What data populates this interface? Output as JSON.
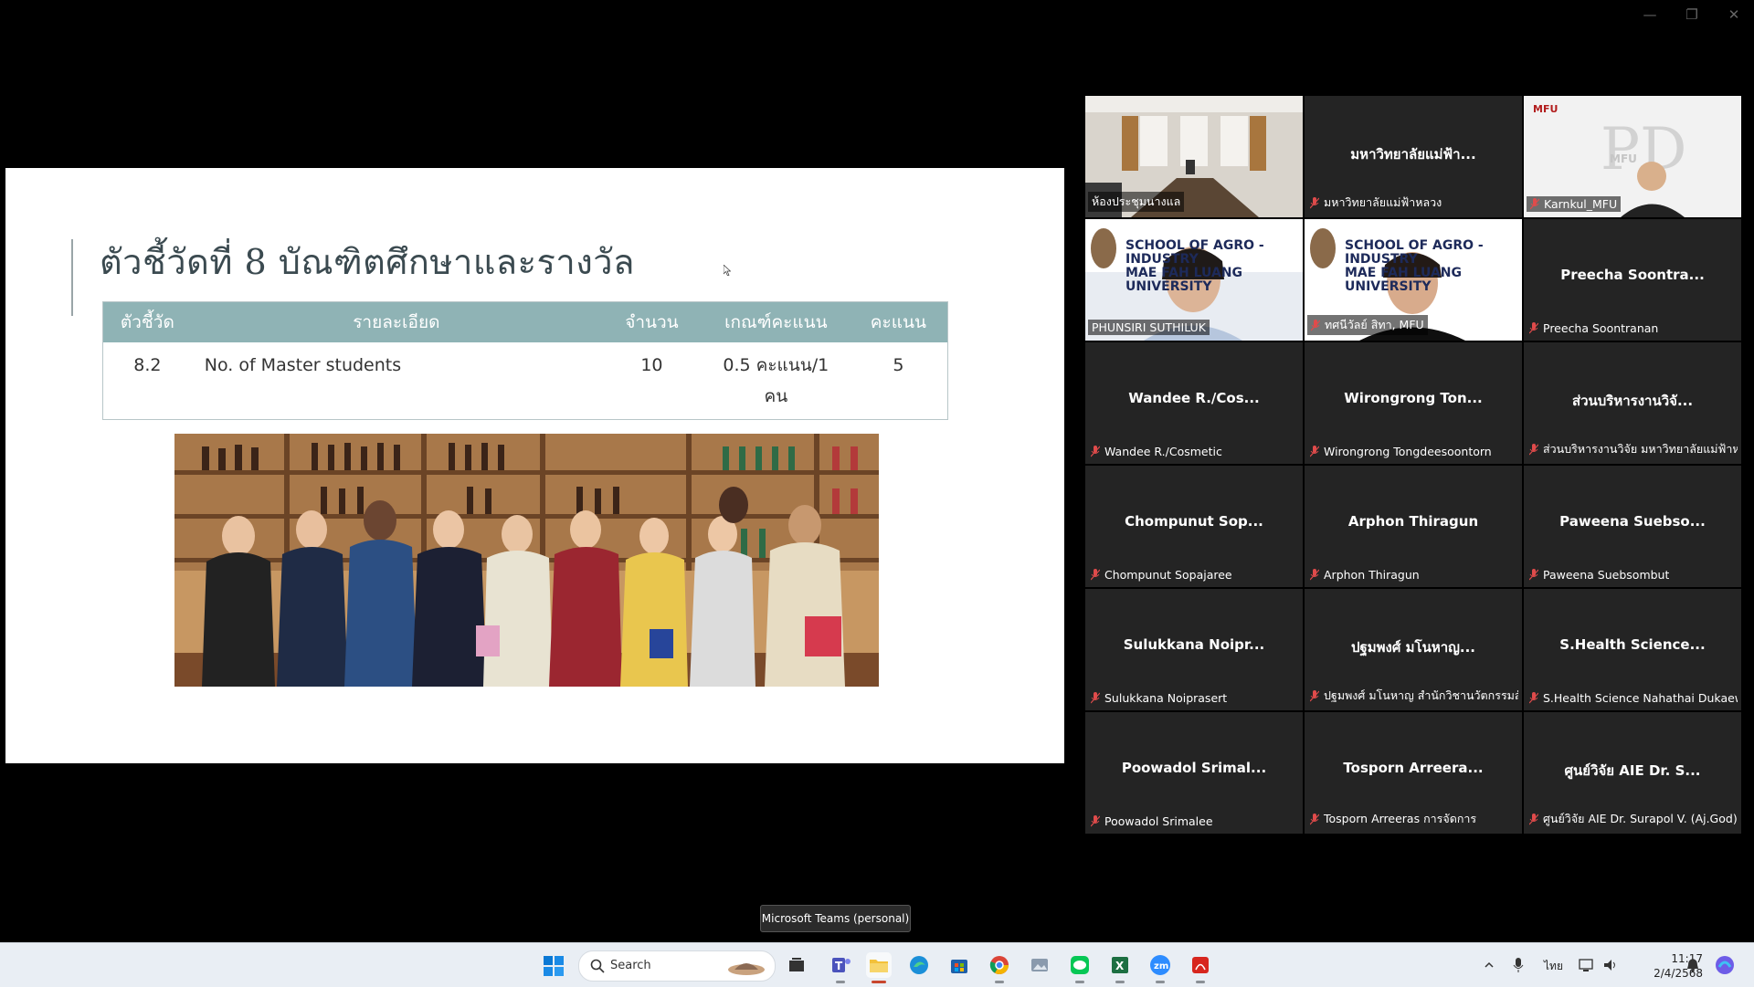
{
  "window": {
    "controls": [
      "minimize",
      "restore",
      "close"
    ]
  },
  "slide": {
    "title": "ตัวชี้วัดที่ 8 บัณฑิตศึกษาและรางวัล",
    "table": {
      "headers": [
        "ตัวชี้วัด",
        "รายละเอียด",
        "จำนวน",
        "เกณฑ์คะแนน",
        "คะแนน"
      ],
      "rows": [
        {
          "indicator": "8.2",
          "detail": "No. of Master students",
          "count": "10",
          "criteria": "0.5 คะแนน/1 คน",
          "score": "5"
        }
      ]
    }
  },
  "gallery": {
    "tiles": [
      {
        "name": "",
        "label": "ห้องประชุมนางแล",
        "type": "video-room",
        "muted": false
      },
      {
        "name": "มหาวิทยาลัยแม่ฟ้า...",
        "label": "มหาวิทยาลัยแม่ฟ้าหลวง",
        "type": "name",
        "muted": true
      },
      {
        "name": "",
        "label": "Karnkul_MFU",
        "type": "video-mfu",
        "muted": true
      },
      {
        "name": "",
        "label": "PHUNSIRI SUTHILUK",
        "type": "video-person",
        "muted": false,
        "active": true
      },
      {
        "name": "",
        "label": "ทศนีวัลย์ สิทา, MFU",
        "type": "video-person2",
        "muted": true
      },
      {
        "name": "Preecha Soontra...",
        "label": "Preecha Soontranan",
        "type": "name",
        "muted": true
      },
      {
        "name": "Wandee R./Cos...",
        "label": "Wandee R./Cosmetic",
        "type": "name",
        "muted": true
      },
      {
        "name": "Wirongrong Ton...",
        "label": "Wirongrong Tongdeesoontorn",
        "type": "name",
        "muted": true
      },
      {
        "name": "ส่วนบริหารงานวิจั...",
        "label": "ส่วนบริหารงานวิจัย มหาวิทยาลัยแม่ฟ้าหลวง",
        "type": "name",
        "muted": true
      },
      {
        "name": "Chompunut Sop...",
        "label": "Chompunut Sopajaree",
        "type": "name",
        "muted": true
      },
      {
        "name": "Arphon Thiragun",
        "label": "Arphon Thiragun",
        "type": "name",
        "muted": true
      },
      {
        "name": "Paweena Suebso...",
        "label": "Paweena Suebsombut",
        "type": "name",
        "muted": true
      },
      {
        "name": "Sulukkana Noipr...",
        "label": "Sulukkana Noiprasert",
        "type": "name",
        "muted": true
      },
      {
        "name": "ปฐมพงศ์ มโนหาญ...",
        "label": "ปฐมพงศ์ มโนหาญ สำนักวิชานวัตกรรมสังคม",
        "type": "name",
        "muted": true
      },
      {
        "name": "S.Health Science...",
        "label": "S.Health Science Nahathai Dukaew",
        "type": "name",
        "muted": true
      },
      {
        "name": "Poowadol Srimal...",
        "label": "Poowadol Srimalee",
        "type": "name",
        "muted": true
      },
      {
        "name": "Tosporn Arreera...",
        "label": "Tosporn Arreeras การจัดการ",
        "type": "name",
        "muted": true
      },
      {
        "name": "ศูนย์วิจัย AIE Dr. S...",
        "label": "ศูนย์วิจัย AIE Dr. Surapol V. (Aj.God)",
        "type": "name",
        "muted": true
      }
    ],
    "logo_text": {
      "mfu": "MFU",
      "mfu_badge": "MFU",
      "banner_line1": "SCHOOL OF AGRO - INDUSTRY",
      "banner_line2": "MAE FAH LUANG UNIVERSITY"
    }
  },
  "tooltip": "Microsoft Teams (personal)",
  "taskbar": {
    "search_label": "Search",
    "apps": [
      "task-view",
      "teams",
      "file-explorer",
      "edge",
      "store",
      "chrome",
      "photos",
      "line",
      "excel",
      "zoom",
      "acrobat"
    ],
    "tray": {
      "language": "ไทย",
      "time": "11:17",
      "date": "2/4/2568"
    }
  }
}
